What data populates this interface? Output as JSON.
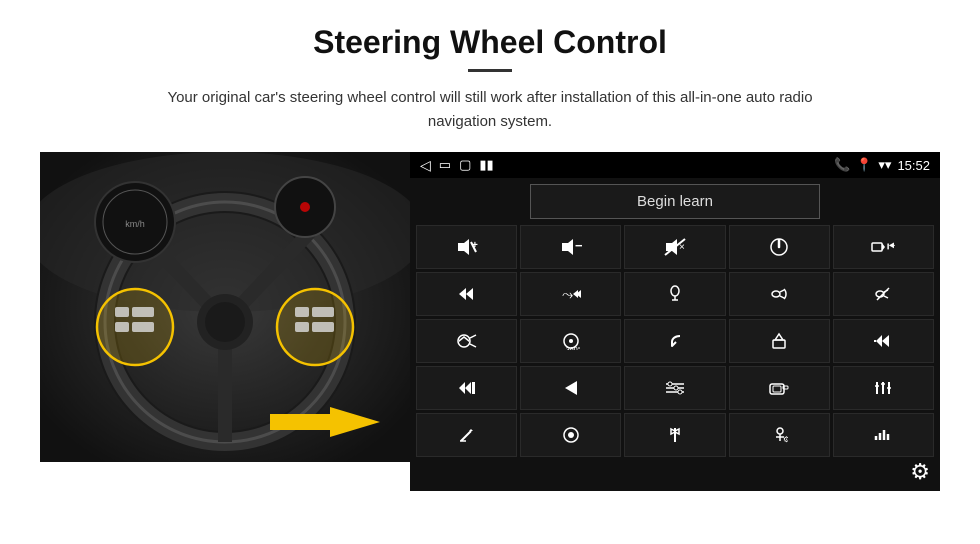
{
  "header": {
    "title": "Steering Wheel Control",
    "subtitle": "Your original car's steering wheel control will still work after installation of this all-in-one auto radio navigation system."
  },
  "status_bar": {
    "time": "15:52",
    "icons": [
      "phone",
      "location",
      "wifi",
      "signal"
    ]
  },
  "begin_learn": {
    "label": "Begin learn"
  },
  "icon_grid": [
    [
      {
        "name": "vol-up",
        "icon": "🔊+",
        "unicode": "🔊"
      },
      {
        "name": "vol-down",
        "icon": "🔉-",
        "unicode": "🔉"
      },
      {
        "name": "mute",
        "icon": "🔇",
        "unicode": "🔇"
      },
      {
        "name": "power",
        "icon": "⏻",
        "unicode": "⏻"
      },
      {
        "name": "prev-track",
        "icon": "📞⏮",
        "unicode": "⏮"
      }
    ],
    [
      {
        "name": "next-track",
        "icon": "⏭",
        "unicode": "⏭"
      },
      {
        "name": "shuffle",
        "icon": "⏩",
        "unicode": "⏩"
      },
      {
        "name": "mic",
        "icon": "🎤",
        "unicode": "🎤"
      },
      {
        "name": "phone",
        "icon": "📞",
        "unicode": "📞"
      },
      {
        "name": "hangup",
        "icon": "📵",
        "unicode": "📵"
      }
    ],
    [
      {
        "name": "horn",
        "icon": "📣",
        "unicode": "📣"
      },
      {
        "name": "camera360",
        "icon": "📷",
        "unicode": "📷"
      },
      {
        "name": "back",
        "icon": "↩",
        "unicode": "↩"
      },
      {
        "name": "home",
        "icon": "🏠",
        "unicode": "🏠"
      },
      {
        "name": "rewind",
        "icon": "⏮⏮",
        "unicode": "⏮"
      }
    ],
    [
      {
        "name": "fastforward",
        "icon": "⏭⏭",
        "unicode": "⏭"
      },
      {
        "name": "navigate",
        "icon": "▶",
        "unicode": "▶"
      },
      {
        "name": "eq",
        "icon": "⇄",
        "unicode": "⇄"
      },
      {
        "name": "camera",
        "icon": "📷",
        "unicode": "📷"
      },
      {
        "name": "equalizer",
        "icon": "🎚",
        "unicode": "🎚"
      }
    ],
    [
      {
        "name": "edit",
        "icon": "✏",
        "unicode": "✏"
      },
      {
        "name": "record",
        "icon": "⏺",
        "unicode": "⏺"
      },
      {
        "name": "bluetooth",
        "icon": "✦",
        "unicode": "✦"
      },
      {
        "name": "music",
        "icon": "🎵",
        "unicode": "🎵"
      },
      {
        "name": "waveform",
        "icon": "📶",
        "unicode": "📶"
      }
    ]
  ],
  "settings": {
    "icon": "⚙"
  }
}
